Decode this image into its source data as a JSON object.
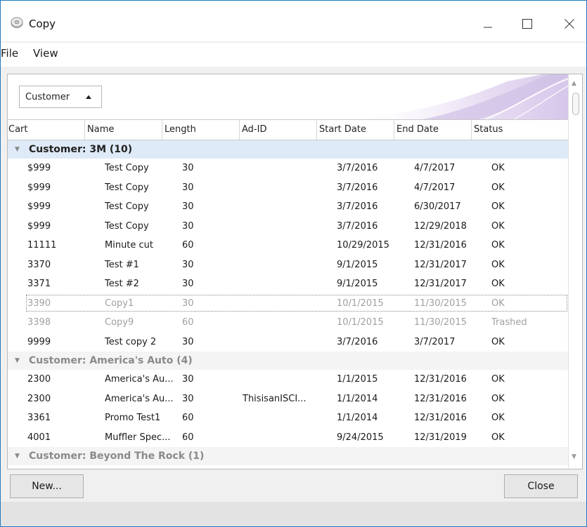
{
  "window": {
    "title": "Copy",
    "icon": "disc-icon",
    "controls": [
      "minimize-icon",
      "maximize-icon",
      "close-icon"
    ]
  },
  "menu": {
    "items": [
      {
        "label": "File"
      },
      {
        "label": "View"
      }
    ]
  },
  "group_panel": {
    "group_by_label": "Customer",
    "sort_icon": "triangle-up-icon"
  },
  "columns": [
    "Cart",
    "Name",
    "Length",
    "Ad-ID",
    "Start Date",
    "End Date",
    "Status"
  ],
  "groups": [
    {
      "label": "Customer: 3M (10)",
      "rows": [
        {
          "cart": "$999",
          "name": "Test Copy",
          "length": "30",
          "adid": "",
          "start": "3/7/2016",
          "end": "4/7/2017",
          "status": "OK"
        },
        {
          "cart": "$999",
          "name": "Test Copy",
          "length": "30",
          "adid": "",
          "start": "3/7/2016",
          "end": "4/7/2017",
          "status": "OK"
        },
        {
          "cart": "$999",
          "name": "Test Copy",
          "length": "30",
          "adid": "",
          "start": "3/7/2016",
          "end": "6/30/2017",
          "status": "OK"
        },
        {
          "cart": "$999",
          "name": "Test Copy",
          "length": "30",
          "adid": "",
          "start": "3/7/2016",
          "end": "12/29/2018",
          "status": "OK"
        },
        {
          "cart": "11111",
          "name": "Minute cut",
          "length": "60",
          "adid": "",
          "start": "10/29/2015",
          "end": "12/31/2016",
          "status": "OK"
        },
        {
          "cart": "3370",
          "name": "Test #1",
          "length": "30",
          "adid": "",
          "start": "9/1/2015",
          "end": "12/31/2017",
          "status": "OK"
        },
        {
          "cart": "3371",
          "name": "Test #2",
          "length": "30",
          "adid": "",
          "start": "9/1/2015",
          "end": "12/31/2017",
          "status": "OK"
        },
        {
          "cart": "3390",
          "name": "Copy1",
          "length": "30",
          "adid": "",
          "start": "10/1/2015",
          "end": "11/30/2015",
          "status": "OK",
          "state": "focused"
        },
        {
          "cart": "3398",
          "name": "Copy9",
          "length": "60",
          "adid": "",
          "start": "10/1/2015",
          "end": "11/30/2015",
          "status": "Trashed",
          "state": "trashed"
        },
        {
          "cart": "9999",
          "name": "Test copy 2",
          "length": "30",
          "adid": "",
          "start": "3/7/2016",
          "end": "3/7/2017",
          "status": "OK"
        }
      ]
    },
    {
      "label": "Customer: America's Auto (4)",
      "rows": [
        {
          "cart": "2300",
          "name": "America's Au...",
          "length": "30",
          "adid": "",
          "start": "1/1/2015",
          "end": "12/31/2016",
          "status": "OK"
        },
        {
          "cart": "2300",
          "name": "America's Au...",
          "length": "30",
          "adid": "ThisisanISCI...",
          "start": "1/1/2014",
          "end": "12/31/2016",
          "status": "OK"
        },
        {
          "cart": "3361",
          "name": "Promo Test1",
          "length": "60",
          "adid": "",
          "start": "1/1/2014",
          "end": "12/31/2016",
          "status": "OK"
        },
        {
          "cart": "4001",
          "name": "Muffler Spec...",
          "length": "60",
          "adid": "",
          "start": "9/24/2015",
          "end": "12/31/2019",
          "status": "OK"
        }
      ]
    },
    {
      "label": "Customer: Beyond The Rock (1)",
      "rows": []
    }
  ],
  "buttons": {
    "new_label": "New...",
    "close_label": "Close"
  },
  "colors": {
    "selected_group": "#dfeaf8",
    "accent_border": "#1f7ac0"
  }
}
